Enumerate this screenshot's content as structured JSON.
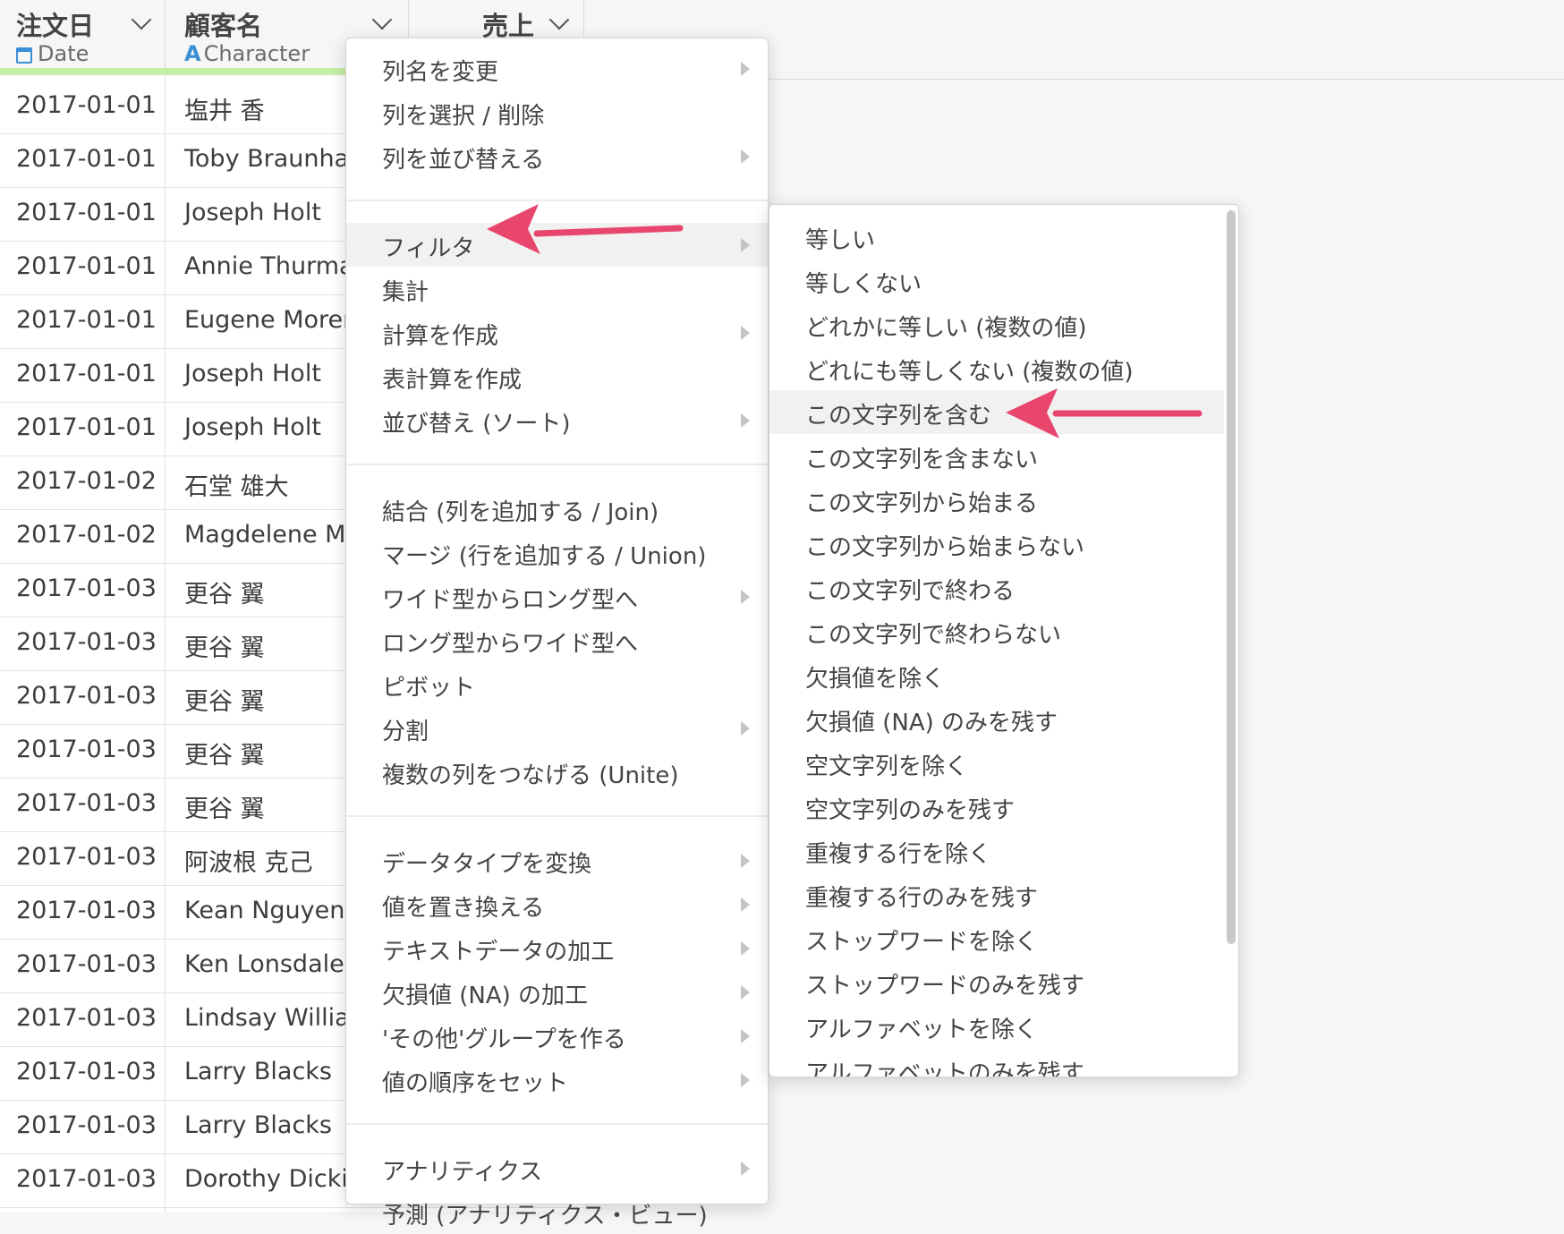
{
  "columns": [
    {
      "name": "注文日",
      "type": "Date"
    },
    {
      "name": "顧客名",
      "type": "Character"
    },
    {
      "name": "売上",
      "type": ""
    }
  ],
  "type_icons": {
    "date": "calendar-icon",
    "character": "character-type-icon"
  },
  "rows": [
    {
      "date": "2017-01-01",
      "name": "塩井 香"
    },
    {
      "date": "2017-01-01",
      "name": "Toby Braunhar"
    },
    {
      "date": "2017-01-01",
      "name": "Joseph Holt"
    },
    {
      "date": "2017-01-01",
      "name": "Annie Thurmar"
    },
    {
      "date": "2017-01-01",
      "name": "Eugene Moren"
    },
    {
      "date": "2017-01-01",
      "name": "Joseph Holt"
    },
    {
      "date": "2017-01-01",
      "name": "Joseph Holt"
    },
    {
      "date": "2017-01-02",
      "name": "石堂 雄大"
    },
    {
      "date": "2017-01-02",
      "name": "Magdelene Mc"
    },
    {
      "date": "2017-01-03",
      "name": "更谷 翼"
    },
    {
      "date": "2017-01-03",
      "name": "更谷 翼"
    },
    {
      "date": "2017-01-03",
      "name": "更谷 翼"
    },
    {
      "date": "2017-01-03",
      "name": "更谷 翼"
    },
    {
      "date": "2017-01-03",
      "name": "更谷 翼"
    },
    {
      "date": "2017-01-03",
      "name": "阿波根 克己"
    },
    {
      "date": "2017-01-03",
      "name": "Kean Nguyen"
    },
    {
      "date": "2017-01-03",
      "name": "Ken Lonsdale"
    },
    {
      "date": "2017-01-03",
      "name": "Lindsay Willian"
    },
    {
      "date": "2017-01-03",
      "name": "Larry Blacks"
    },
    {
      "date": "2017-01-03",
      "name": "Larry Blacks"
    },
    {
      "date": "2017-01-03",
      "name": "Dorothy Dickin"
    }
  ],
  "context_menu": {
    "groups": [
      [
        {
          "label": "列名を変更",
          "submenu": true
        },
        {
          "label": "列を選択 / 削除",
          "submenu": false
        },
        {
          "label": "列を並び替える",
          "submenu": true
        }
      ],
      [
        {
          "label": "フィルタ",
          "submenu": true,
          "highlighted": true
        },
        {
          "label": "集計",
          "submenu": false
        },
        {
          "label": "計算を作成",
          "submenu": true
        },
        {
          "label": "表計算を作成",
          "submenu": false
        },
        {
          "label": "並び替え (ソート)",
          "submenu": true
        }
      ],
      [
        {
          "label": "結合 (列を追加する / Join)",
          "submenu": false
        },
        {
          "label": "マージ (行を追加する / Union)",
          "submenu": false
        },
        {
          "label": "ワイド型からロング型へ",
          "submenu": true
        },
        {
          "label": "ロング型からワイド型へ",
          "submenu": false
        },
        {
          "label": "ピボット",
          "submenu": false
        },
        {
          "label": "分割",
          "submenu": true
        },
        {
          "label": "複数の列をつなげる (Unite)",
          "submenu": false
        }
      ],
      [
        {
          "label": "データタイプを変換",
          "submenu": true
        },
        {
          "label": "値を置き換える",
          "submenu": true
        },
        {
          "label": "テキストデータの加工",
          "submenu": true
        },
        {
          "label": "欠損値 (NA) の加工",
          "submenu": true
        },
        {
          "label": "'その他'グループを作る",
          "submenu": true
        },
        {
          "label": "値の順序をセット",
          "submenu": true
        }
      ],
      [
        {
          "label": "アナリティクス",
          "submenu": true
        },
        {
          "label": "予測 (アナリティクス・ビュー)",
          "submenu": false
        }
      ]
    ]
  },
  "filter_submenu": {
    "items": [
      {
        "label": "等しい"
      },
      {
        "label": "等しくない"
      },
      {
        "label": "どれかに等しい (複数の値)"
      },
      {
        "label": "どれにも等しくない (複数の値)"
      },
      {
        "label": "この文字列を含む",
        "highlighted": true
      },
      {
        "label": "この文字列を含まない"
      },
      {
        "label": "この文字列から始まる"
      },
      {
        "label": "この文字列から始まらない"
      },
      {
        "label": "この文字列で終わる"
      },
      {
        "label": "この文字列で終わらない"
      },
      {
        "label": "欠損値を除く"
      },
      {
        "label": "欠損値 (NA) のみを残す"
      },
      {
        "label": "空文字列を除く"
      },
      {
        "label": "空文字列のみを残す"
      },
      {
        "label": "重複する行を除く"
      },
      {
        "label": "重複する行のみを残す"
      },
      {
        "label": "ストップワードを除く"
      },
      {
        "label": "ストップワードのみを残す"
      },
      {
        "label": "アルファベットを除く"
      },
      {
        "label": "アルファベットのみを残す"
      }
    ]
  },
  "colors": {
    "accent_arrow": "#e8466d",
    "green_bar": "#c4efa6",
    "type_blue": "#3b8fd6"
  }
}
